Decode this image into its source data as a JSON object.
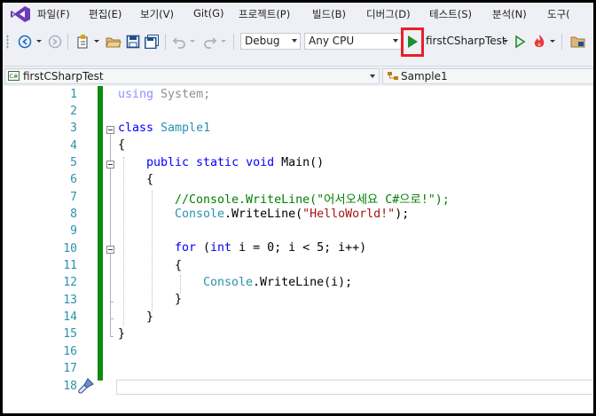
{
  "menu": [
    "파일(F)",
    "편집(E)",
    "보기(V)",
    "Git(G)",
    "프로젝트(P)",
    "빌드(B)",
    "디버그(D)",
    "테스트(S)",
    "분석(N)",
    "도구("
  ],
  "toolbar": {
    "configuration": "Debug",
    "platform": "Any CPU",
    "startup_project": "firstCSharpTest"
  },
  "navigation": {
    "project_icon_text": "C#",
    "project": "firstCSharpTest",
    "type": "Sample1"
  },
  "editor": {
    "line_numbers": [
      "1",
      "2",
      "3",
      "4",
      "5",
      "6",
      "7",
      "8",
      "9",
      "10",
      "11",
      "12",
      "13",
      "14",
      "15",
      "16",
      "17",
      "18"
    ],
    "lines": {
      "l1_kw": "using",
      "l1_ns": " System;",
      "l3_kw": "class",
      "l3_name": " Sample1",
      "l4": "{",
      "l5_kw": "public static void",
      "l5_rest": " Main()",
      "l6": "{",
      "l7": "//Console.WriteLine(\"어서오세요 C#으로!\");",
      "l8_type": "Console",
      "l8_mid": ".WriteLine(",
      "l8_str": "\"HelloWorld!\"",
      "l8_end": ");",
      "l10_for": "for",
      "l10_p1": " (",
      "l10_int": "int",
      "l10_p2": " i = 0; i < 5; i++)",
      "l11": "{",
      "l12_type": "Console",
      "l12_rest": ".WriteLine(i);",
      "l13": "}",
      "l14": "}",
      "l15": "}"
    }
  },
  "colors": {
    "keyword": "#0000FF",
    "type": "#2B91AF",
    "comment": "#008000",
    "string": "#A31515",
    "change_bar": "#108A10",
    "highlight": "#E8202A"
  }
}
